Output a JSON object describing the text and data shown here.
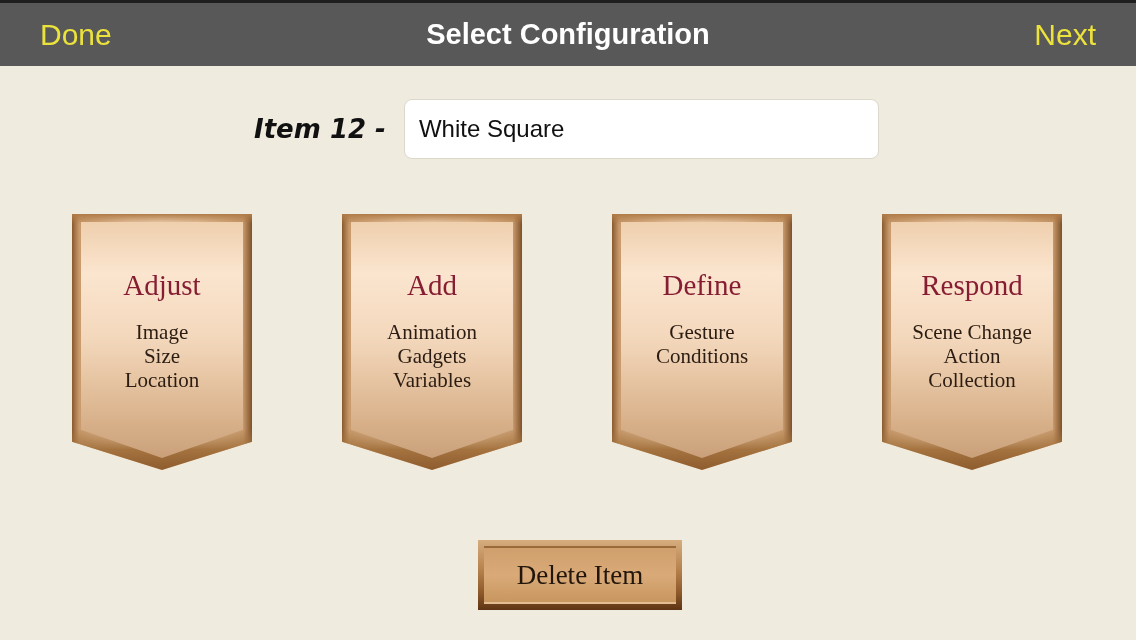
{
  "nav_bar": {
    "left_button": "Done",
    "title": "Select Configuration",
    "right_button": "Next"
  },
  "item": {
    "label": "Item 12 -",
    "name_field": {
      "value": "White Square"
    }
  },
  "categories": [
    {
      "title": "Adjust",
      "lines": [
        "Image",
        "Size",
        "Location"
      ]
    },
    {
      "title": "Add",
      "lines": [
        "Animation",
        "Gadgets",
        "Variables"
      ]
    },
    {
      "title": "Define",
      "lines": [
        "Gesture",
        "Conditions"
      ]
    },
    {
      "title": "Respond",
      "lines": [
        "Scene Change",
        "Action",
        "Collection"
      ]
    }
  ],
  "delete_button": "Delete Item"
}
